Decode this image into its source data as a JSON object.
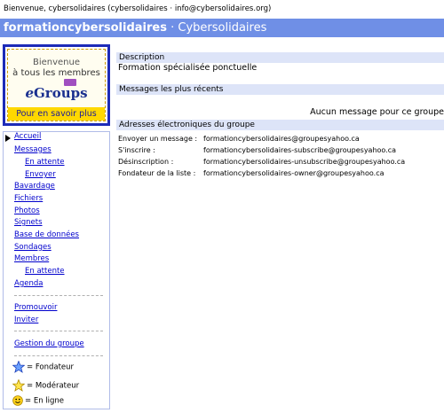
{
  "header": {
    "welcome": "Bienvenue, cybersolidaires (cybersolidaires · info@cybersolidaires.org)",
    "group_name": "formationcybersolidaires",
    "group_suffix": "· Cybersolidaires"
  },
  "banner": {
    "line1": "Bienvenue",
    "line2": "à tous les membres",
    "logo_e": "e",
    "logo_rest": "Groups",
    "cta": "Pour en savoir plus"
  },
  "sidebar": {
    "items": [
      {
        "label": "Accueil"
      },
      {
        "label": "Messages"
      },
      {
        "label": "En attente"
      },
      {
        "label": "Envoyer"
      },
      {
        "label": "Bavardage"
      },
      {
        "label": "Fichiers"
      },
      {
        "label": "Photos"
      },
      {
        "label": "Signets"
      },
      {
        "label": "Base de données"
      },
      {
        "label": "Sondages"
      },
      {
        "label": "Membres"
      },
      {
        "label": "En attente"
      },
      {
        "label": "Agenda"
      },
      {
        "label": "Promouvoir"
      },
      {
        "label": "Inviter"
      },
      {
        "label": "Gestion du groupe"
      }
    ],
    "legend": [
      {
        "icon": "blue-star-icon",
        "label": "= Fondateur"
      },
      {
        "icon": "yellow-star-icon",
        "label": "= Modérateur"
      },
      {
        "icon": "smiley-icon",
        "label": "= En ligne"
      }
    ]
  },
  "main": {
    "description_title": "Description",
    "description_text": "Formation spécialisée ponctuelle",
    "recent_title": "Messages les plus récents",
    "no_messages": "Aucun message pour ce groupe",
    "addresses_title": "Adresses électroniques du groupe",
    "addresses": [
      {
        "label": "Envoyer un message :",
        "value": "formationcybersolidaires@groupesyahoo.ca"
      },
      {
        "label": "S'inscrire :",
        "value": "formationcybersolidaires-subscribe@groupesyahoo.ca"
      },
      {
        "label": "Désinscription :",
        "value": "formationcybersolidaires-unsubscribe@groupesyahoo.ca"
      },
      {
        "label": "Fondateur de la liste :",
        "value": "formationcybersolidaires-owner@groupesyahoo.ca"
      }
    ]
  },
  "colors": {
    "group_bar": "#6f8fe6",
    "section_bar": "#dde4f8",
    "link": "#0000cc",
    "banner_border": "#1d2bb8",
    "banner_cta": "#ffd800"
  }
}
